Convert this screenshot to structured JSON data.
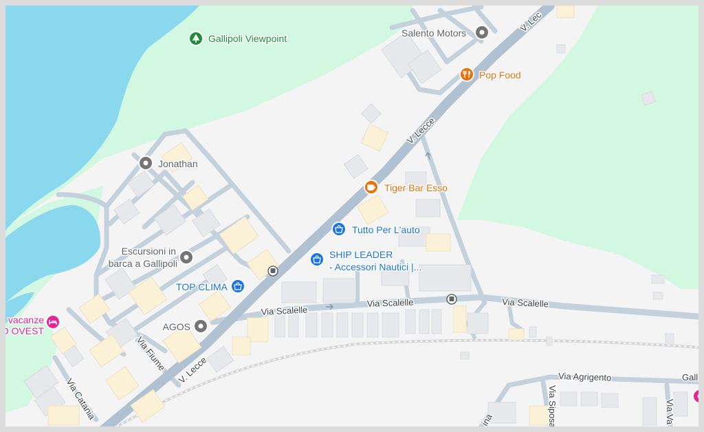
{
  "map": {
    "colors": {
      "water": "#8ad8ee",
      "park": "#d3f8e2",
      "land": "#f4f4f4",
      "road": "#c3d1dd",
      "road_major": "#aebfcf",
      "building": "#e6e8ec",
      "building_warm": "#fbf1d7",
      "frame": "#dcdcdc",
      "railway": "#d9d9d9"
    },
    "pois": [
      {
        "name": "Gallipoli Viewpoint",
        "icon": "park-icon",
        "color": "#1e8e3e"
      },
      {
        "name": "Salento Motors",
        "icon": "place-pin-icon",
        "color": "#5f6368"
      },
      {
        "name": "Pop Food",
        "icon": "restaurant-icon",
        "color": "#e8710a"
      },
      {
        "name": "Jonathan",
        "icon": "place-pin-icon",
        "color": "#5f6368"
      },
      {
        "name": "Tiger Bar Esso",
        "icon": "cafe-icon",
        "color": "#e8710a"
      },
      {
        "name": "Tutto Per L'auto",
        "icon": "shopping-bag-icon",
        "color": "#1a73e8"
      },
      {
        "name": "SHIP LEADER",
        "name_line2": "- Accessori Nautici |...",
        "icon": "shopping-bag-icon",
        "color": "#1a73e8"
      },
      {
        "name": "Escursioni in",
        "name_line2": "barca a Gallipoli",
        "icon": "place-pin-icon",
        "color": "#5f6368"
      },
      {
        "name": "TOP CLIMA",
        "icon": "shopping-bag-icon",
        "color": "#1a73e8"
      },
      {
        "name": "AGOS",
        "icon": "place-pin-icon",
        "color": "#5f6368"
      },
      {
        "name": "vacanze",
        "name_line2": "O OVEST",
        "icon": "hotel-icon",
        "color": "#e52592"
      }
    ],
    "roads": {
      "v_lecce": "V. Lecce",
      "v_lecce_partial": "V. Lec",
      "via_scalelle": "Via Scalelle",
      "via_fiume": "Via Fiume",
      "via_catania": "Via Catania",
      "via_agrigento": "Via Agrigento",
      "via_siposano_partial": "Via Siposano",
      "via_va_partial": "Via Va",
      "gall_partial": "Gall",
      "ina_partial": "ina"
    },
    "transit_icon": "bus-stop-icon"
  }
}
